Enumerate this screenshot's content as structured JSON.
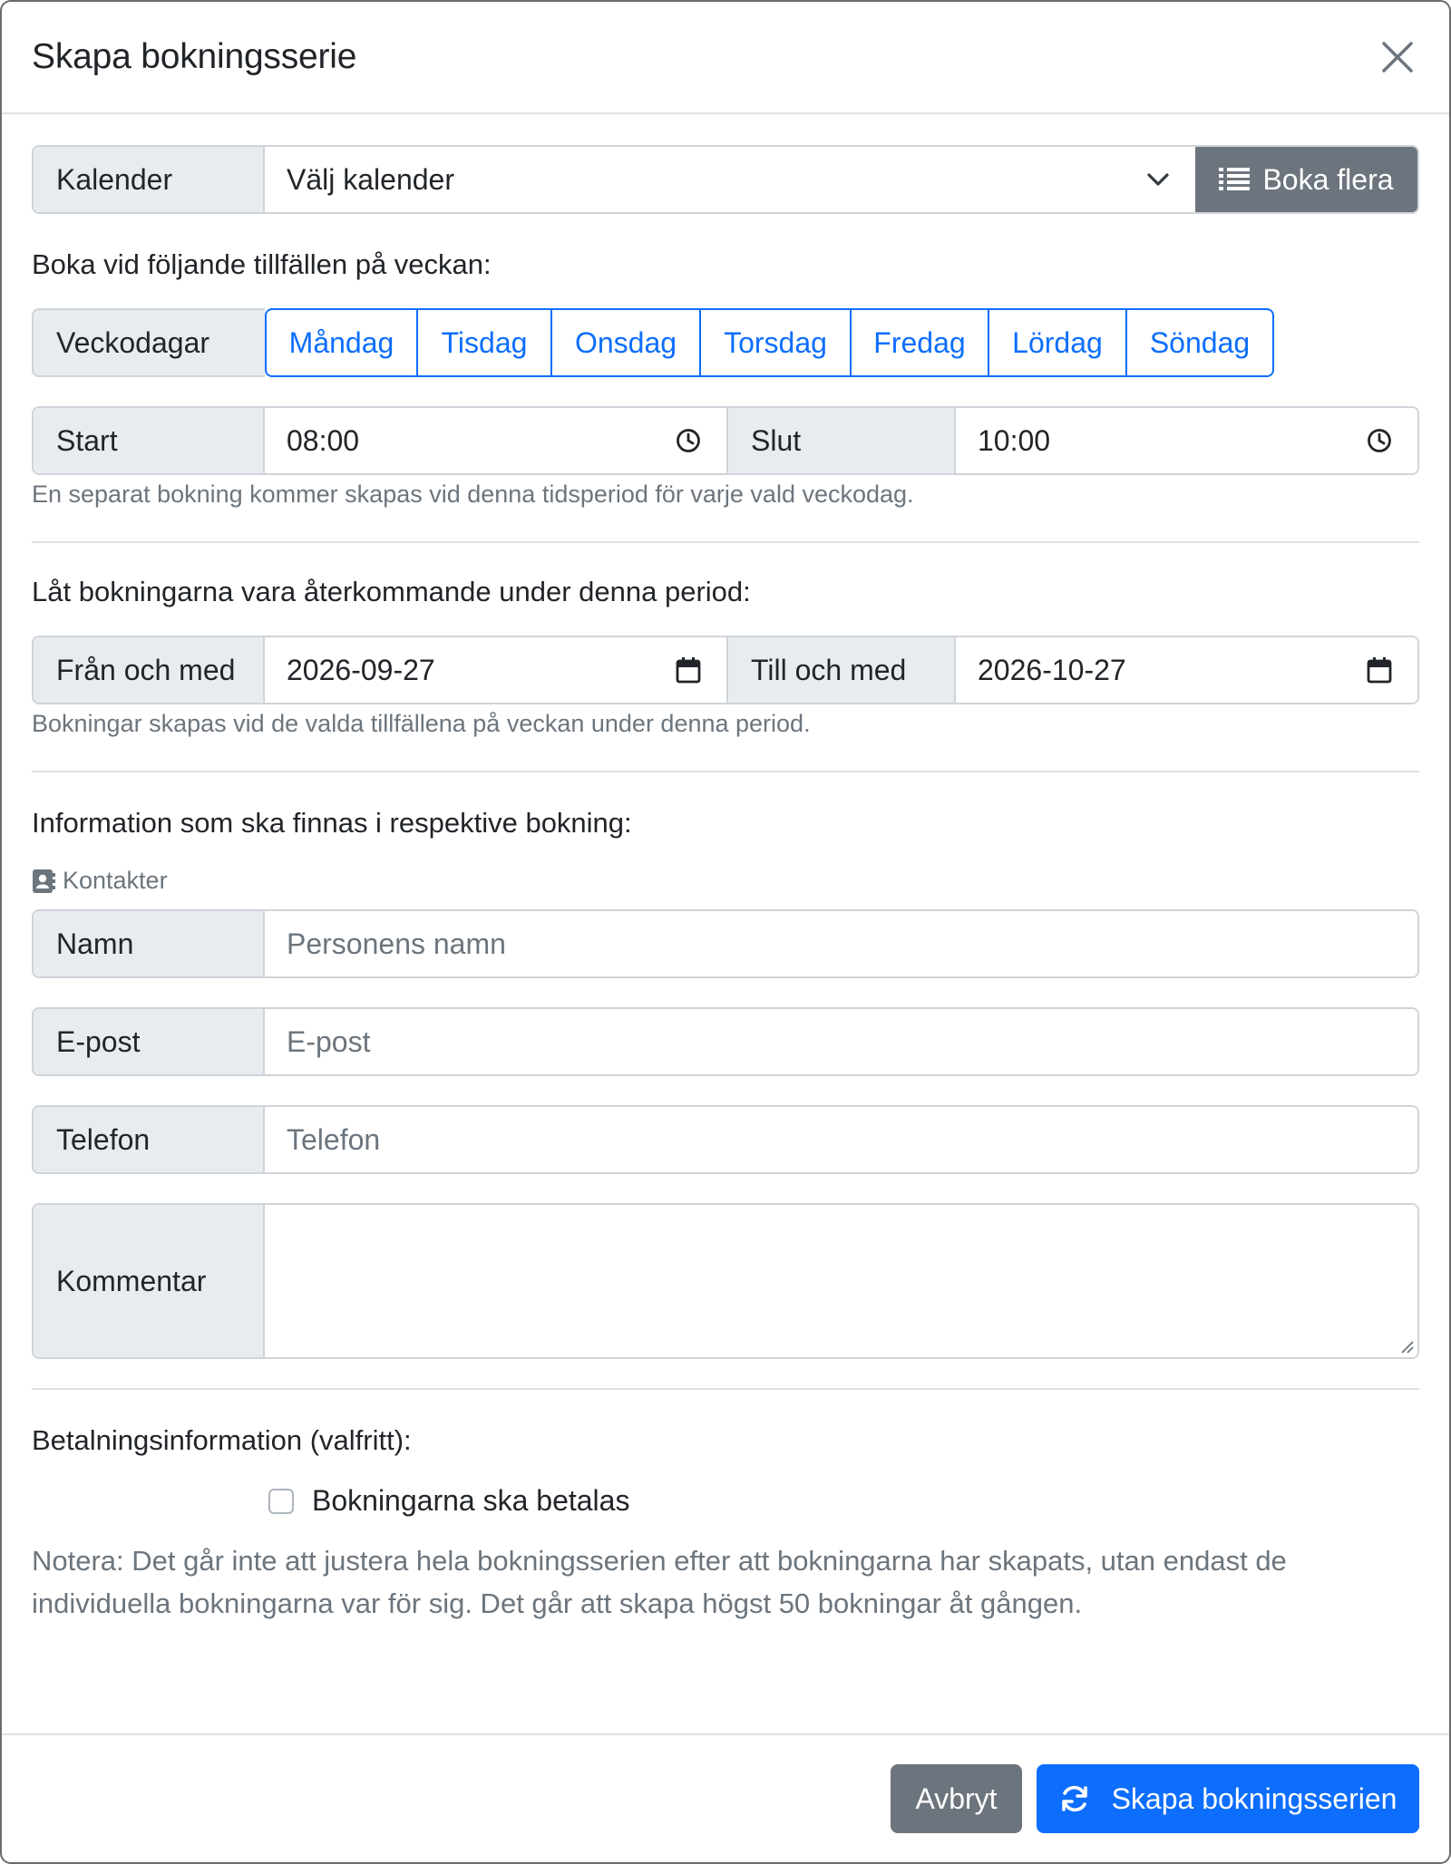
{
  "modal": {
    "title": "Skapa bokningsserie"
  },
  "calendar": {
    "label": "Kalender",
    "select_value": "Välj kalender",
    "book_many_label": "Boka flera"
  },
  "weekdays": {
    "heading": "Boka vid följande tillfällen på veckan:",
    "label": "Veckodagar",
    "days": [
      "Måndag",
      "Tisdag",
      "Onsdag",
      "Torsdag",
      "Fredag",
      "Lördag",
      "Söndag"
    ]
  },
  "time": {
    "start_label": "Start",
    "start_value": "08:00",
    "end_label": "Slut",
    "end_value": "10:00",
    "help": "En separat bokning kommer skapas vid denna tidsperiod för varje vald veckodag."
  },
  "period": {
    "heading": "Låt bokningarna vara återkommande under denna period:",
    "from_label": "Från och med",
    "from_value": "2026-09-27",
    "to_label": "Till och med",
    "to_value": "2026-10-27",
    "help": "Bokningar skapas vid de valda tillfällena på veckan under denna period."
  },
  "info": {
    "heading": "Information som ska finnas i respektive bokning:",
    "contacts_label": "Kontakter",
    "name_label": "Namn",
    "name_placeholder": "Personens namn",
    "email_label": "E-post",
    "email_placeholder": "E-post",
    "phone_label": "Telefon",
    "phone_placeholder": "Telefon",
    "comment_label": "Kommentar"
  },
  "payment": {
    "heading": "Betalningsinformation (valfritt):",
    "checkbox_label": "Bokningarna ska betalas",
    "note": "Notera: Det går inte att justera hela bokningsserien efter att bokningarna har skapats, utan endast de individuella bokningarna var för sig. Det går att skapa högst 50 bokningar åt gången."
  },
  "footer": {
    "cancel_label": "Avbryt",
    "submit_label": "Skapa bokningsserien"
  },
  "colors": {
    "primary": "#0d6efd",
    "secondary": "#6c757d",
    "addon_bg": "#e9ecef",
    "border": "#ced4da"
  }
}
